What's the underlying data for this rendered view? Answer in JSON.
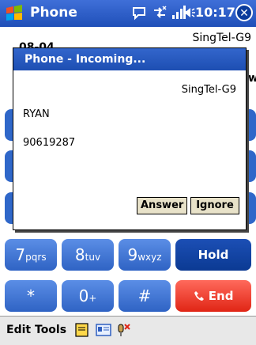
{
  "titlebar": {
    "title": "Phone",
    "time": "10:17",
    "icons": [
      "windows-start-icon",
      "notification-bubble-icon",
      "connectivity-icon",
      "signal-strength-icon",
      "speaker-icon",
      "close-icon"
    ]
  },
  "background_screen": {
    "left_fragment": "08-04",
    "carrier_fragment": "SingTel-G9",
    "right_fragment": "w"
  },
  "dialog": {
    "title": "Phone - Incoming...",
    "carrier": "SingTel-G9",
    "caller_name": "RYAN",
    "caller_number": "90619287",
    "answer_label": "Answer",
    "ignore_label": "Ignore"
  },
  "keypad": {
    "row1": [
      {
        "digit": "7",
        "letters": "pqrs"
      },
      {
        "digit": "8",
        "letters": "tuv"
      },
      {
        "digit": "9",
        "letters": "wxyz"
      }
    ],
    "hold_label": "Hold",
    "row2": [
      {
        "digit": "*",
        "letters": ""
      },
      {
        "digit": "0",
        "letters": "+"
      },
      {
        "digit": "#",
        "letters": ""
      }
    ],
    "end_label": "End"
  },
  "menubar": {
    "edit_label": "Edit",
    "tools_label": "Tools",
    "icons": [
      "notes-icon",
      "contact-card-icon",
      "voice-record-icon"
    ]
  },
  "colors": {
    "titlebar_blue": "#2a5bc6",
    "key_blue": "#3f76d6",
    "key_dark_blue": "#103f9e",
    "end_red": "#e8392a",
    "dialog_button": "#e8e2c9"
  }
}
